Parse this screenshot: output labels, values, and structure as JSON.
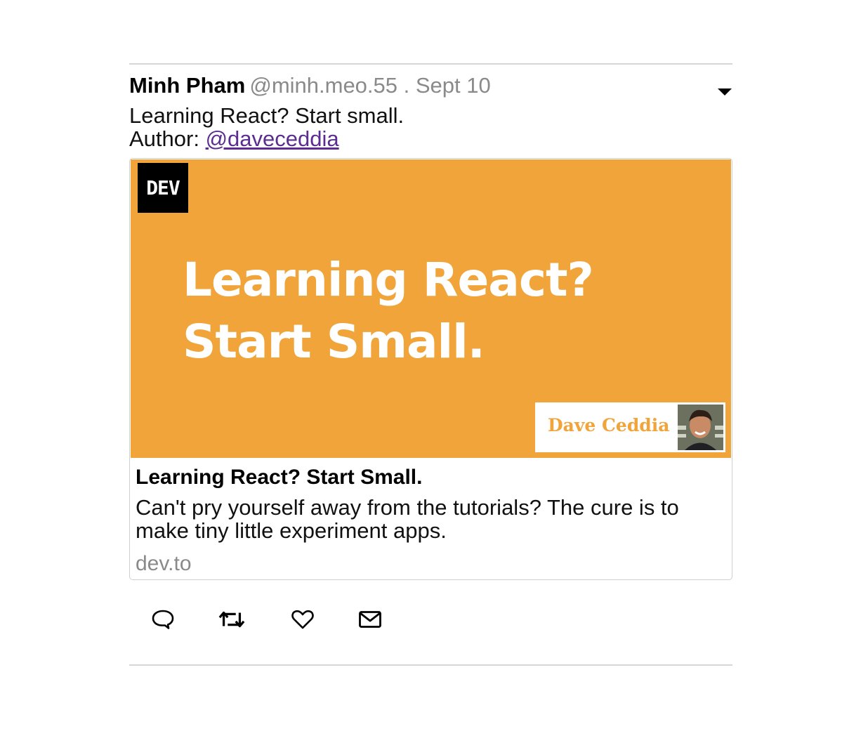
{
  "tweet": {
    "author_name": "Minh Pham",
    "meta": "@minh.meo.55 . Sept 10",
    "text_line1": "Learning React? Start small.",
    "author_prefix": "Author: ",
    "author_link": "@daveceddia",
    "menu_icon": "caret-down-icon"
  },
  "card": {
    "logo_text": "DEV",
    "hero_title": "Learning React? Start Small.",
    "hero_author": "Dave Ceddia",
    "title": "Learning React? Start Small.",
    "description": "Can't pry yourself away from the tutorials? The cure is to make tiny little experiment apps.",
    "domain": "dev.to",
    "hero_color": "#f0a43a"
  },
  "actions": [
    {
      "name": "reply",
      "icon": "speech-bubble-icon"
    },
    {
      "name": "retweet",
      "icon": "retweet-icon"
    },
    {
      "name": "like",
      "icon": "heart-icon"
    },
    {
      "name": "message",
      "icon": "envelope-icon"
    }
  ]
}
